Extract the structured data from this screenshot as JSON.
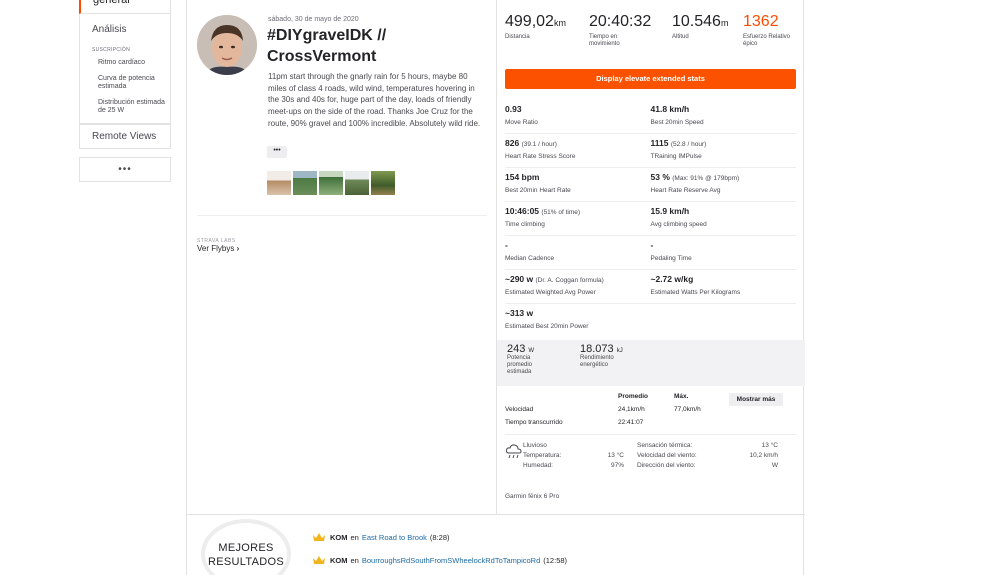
{
  "nav": {
    "top_label": "general",
    "analysis": "Análisis",
    "subscription_heading": "SUSCRIPCIÓN",
    "sub_items": [
      "Ritmo cardíaco",
      "Curva de potencia estimada",
      "Distribución estimada de 25 W"
    ],
    "remote_views": "Remote Views",
    "more": "•••"
  },
  "activity": {
    "date": "sábado, 30 de mayo de 2020",
    "title": "#DIYgraveIDK // CrossVermont",
    "description": "11pm start through the gnarly rain for 5 hours, maybe 80 miles of class 4 roads, wild wind, temperatures hovering in the 30s and 40s for, huge part of the day, loads of friendly meet-ups on the side of the road. Thanks Joe Cruz for the route, 90% gravel and 100% incredible. Absolutely wild ride.",
    "more_button": "•••",
    "labs_heading": "STRAVA LABS",
    "flyby": "Ver Flybys"
  },
  "top_stats": [
    {
      "value": "499,02",
      "unit": "km",
      "label": "Distancia"
    },
    {
      "value": "20:40:32",
      "unit": "",
      "label": "Tiempo en movimiento"
    },
    {
      "value": "10.546",
      "unit": "m",
      "label": "Altitud"
    },
    {
      "value": "1362",
      "unit": "",
      "label": "Esfuerzo Relativo épico"
    }
  ],
  "extended_button": "Display elevate extended stats",
  "extended_stats": [
    [
      {
        "value": "0.93",
        "extra": "",
        "label": "Move Ratio"
      },
      {
        "value": "41.8 km/h",
        "extra": "",
        "label": "Best 20min Speed"
      }
    ],
    [
      {
        "value": "826",
        "extra": "(39.1 / hour)",
        "label": "Heart Rate Stress Score"
      },
      {
        "value": "1115",
        "extra": "(52.8 / hour)",
        "label": "TRaining IMPulse"
      }
    ],
    [
      {
        "value": "154 bpm",
        "extra": "",
        "label": "Best 20min Heart Rate"
      },
      {
        "value": "53 %",
        "extra": "(Max: 91% @ 179bpm)",
        "label": "Heart Rate Reserve Avg"
      }
    ],
    [
      {
        "value": "10:46:05",
        "extra": "(51% of time)",
        "label": "Time climbing"
      },
      {
        "value": "15.9 km/h",
        "extra": "",
        "label": "Avg climbing speed"
      }
    ],
    [
      {
        "value": "-",
        "extra": "",
        "label": "Median Cadence"
      },
      {
        "value": "-",
        "extra": "",
        "label": "Pedaling Time"
      }
    ],
    [
      {
        "value": "~290 w",
        "extra": "(Dr. A. Coggan formula)",
        "label": "Estimated Weighted Avg Power"
      },
      {
        "value": "~2.72 w/kg",
        "extra": "",
        "label": "Estimated Watts Per Kilograms"
      }
    ],
    [
      {
        "value": "~313 w",
        "extra": "",
        "label": "Estimated Best 20min Power"
      }
    ]
  ],
  "power": {
    "avg_value": "243",
    "avg_unit": "W",
    "avg_label": "Potencia promedio estimada",
    "energy_value": "18.073",
    "energy_unit": "kJ",
    "energy_label": "Rendimiento energético"
  },
  "table": {
    "col_avg": "Promedio",
    "col_max": "Máx.",
    "show_more": "Mostrar más",
    "rows": [
      {
        "label": "Velocidad",
        "avg": "24,1km/h",
        "max": "77,0km/h"
      },
      {
        "label": "Tiempo transcurrido",
        "avg": "22:41:07",
        "max": ""
      }
    ]
  },
  "weather": {
    "left": [
      {
        "label": "Lluvioso",
        "value": ""
      },
      {
        "label": "Temperatura:",
        "value": "13 °C"
      },
      {
        "label": "Humedad:",
        "value": "97%"
      }
    ],
    "right": [
      {
        "label": "Sensación térmica:",
        "value": "13 °C"
      },
      {
        "label": "Velocidad del viento:",
        "value": "10,2 km/h"
      },
      {
        "label": "Dirección del viento:",
        "value": "W"
      }
    ]
  },
  "device": "Garmin fēnix 6 Pro",
  "best": {
    "badge_line1": "MEJORES",
    "badge_line2": "RESULTADOS",
    "items": [
      {
        "type": "KOM",
        "prep": "en",
        "segment": "East Road to Brook",
        "time": "(8:28)"
      },
      {
        "type": "KOM",
        "prep": "en",
        "segment": "BourroughsRdSouthFromSWheelockRdToTampicoRd",
        "time": "(12:58)"
      }
    ]
  },
  "colors": {
    "accent": "#fc4c02",
    "link": "#1d6aa5"
  }
}
